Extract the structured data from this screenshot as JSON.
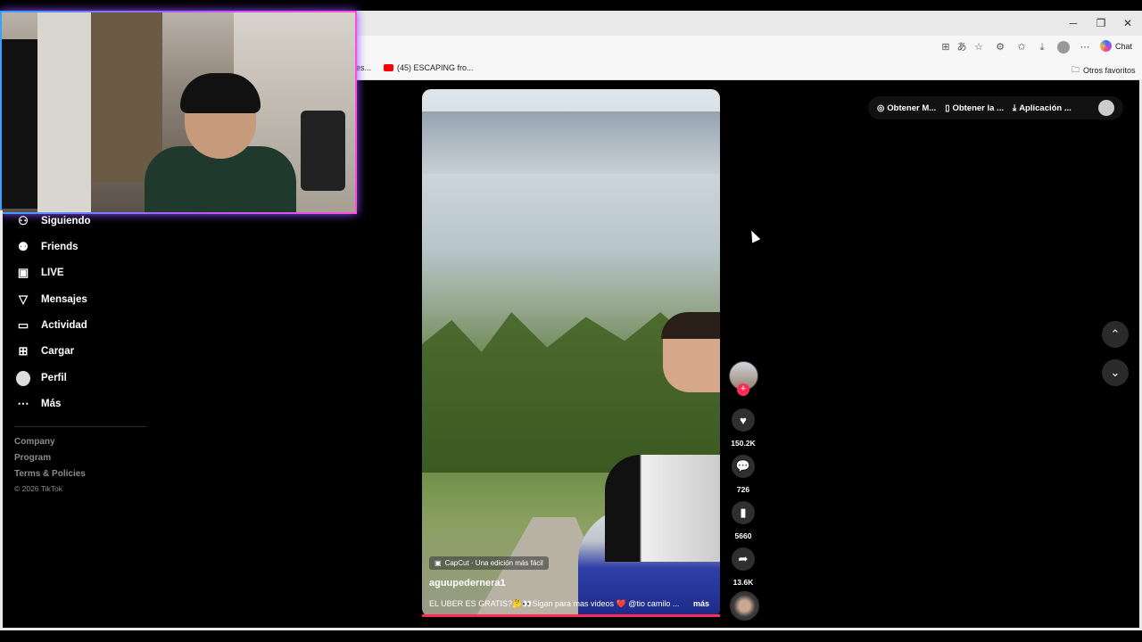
{
  "browser": {
    "window_controls": {
      "minimize": "─",
      "restore": "❐",
      "close": "✕"
    },
    "bookmarks": {
      "partial": "es...",
      "youtube": "(45) ESCAPING fro...",
      "other": "Otros favoritos"
    },
    "chat_label": "Chat"
  },
  "sidebar": {
    "items": [
      {
        "label": "Siguiendo",
        "icon": "following-icon"
      },
      {
        "label": "Friends",
        "icon": "friends-icon"
      },
      {
        "label": "LIVE",
        "icon": "live-icon"
      },
      {
        "label": "Mensajes",
        "icon": "messages-icon"
      },
      {
        "label": "Actividad",
        "icon": "activity-icon"
      },
      {
        "label": "Cargar",
        "icon": "upload-icon"
      },
      {
        "label": "Perfil",
        "icon": "profile-avatar"
      },
      {
        "label": "Más",
        "icon": "more-icon"
      }
    ],
    "footer": {
      "company": "Company",
      "program": "Program",
      "terms": "Terms & Policies",
      "copyright": "© 2026 TikTok"
    }
  },
  "video": {
    "capcut_label": "CapCut · Una edición más fácil",
    "username": "aguupedernera1",
    "description": "EL UBER ES GRATIS?🤔👀Sigan para mas videos ❤️ @tio camilo ...",
    "more": "más"
  },
  "actions": {
    "likes": "150.2K",
    "comments": "726",
    "saves": "5660",
    "shares": "13.6K"
  },
  "topbar": {
    "get_coins": "Obtener M...",
    "get_app": "Obtener la ...",
    "desktop_app": "Aplicación ..."
  },
  "colors": {
    "accent": "#fe2c55",
    "background": "#000000"
  }
}
